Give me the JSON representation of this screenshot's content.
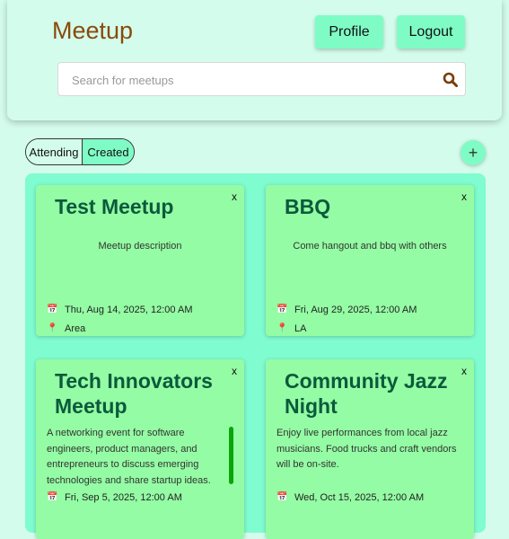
{
  "header": {
    "title": "Meetup",
    "profile_label": "Profile",
    "logout_label": "Logout"
  },
  "search": {
    "placeholder": "Search for meetups",
    "value": ""
  },
  "filter": {
    "attending_label": "Attending",
    "created_label": "Created",
    "selected": "Created"
  },
  "add_button_label": "+",
  "meetups": [
    {
      "title": "Test Meetup",
      "description": "Meetup description",
      "date": "Thu, Aug 14, 2025, 12:00 AM",
      "location": "Area",
      "close_label": "x"
    },
    {
      "title": "BBQ",
      "description": "Come hangout and bbq with others",
      "date": "Fri, Aug 29, 2025, 12:00 AM",
      "location": "LA",
      "close_label": "x"
    },
    {
      "title": "Tech Innovators Meetup",
      "description": "A networking event for software engineers, product managers, and entrepreneurs to discuss emerging technologies and share startup ideas.",
      "date": "Fri, Sep 5, 2025, 12:00 AM",
      "location": "",
      "close_label": "x"
    },
    {
      "title": "Community Jazz Night",
      "description": "Enjoy live performances from local jazz musicians. Food trucks and craft vendors will be on-site.",
      "date": "Wed, Oct 15, 2025, 12:00 AM",
      "location": "",
      "close_label": "x"
    }
  ],
  "icons": {
    "calendar": "calendar-icon",
    "location": "pin-icon",
    "search": "search-icon"
  },
  "colors": {
    "background": "#d4fcec",
    "accent": "#7ffcc6",
    "card": "#94fca4",
    "title_text": "#8a4a0c",
    "card_title": "#0b5a3c"
  }
}
